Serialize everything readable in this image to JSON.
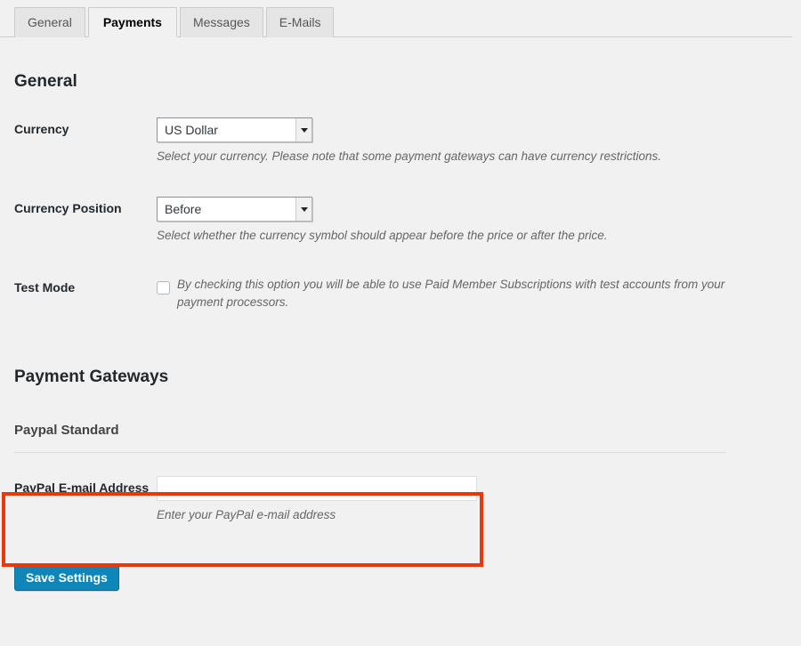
{
  "tabs": [
    {
      "label": "General",
      "active": false
    },
    {
      "label": "Payments",
      "active": true
    },
    {
      "label": "Messages",
      "active": false
    },
    {
      "label": "E-Mails",
      "active": false
    }
  ],
  "general": {
    "heading": "General",
    "currency": {
      "label": "Currency",
      "value": "US Dollar",
      "description": "Select your currency. Please note that some payment gateways can have currency restrictions."
    },
    "currency_position": {
      "label": "Currency Position",
      "value": "Before",
      "description": "Select whether the currency symbol should appear before the price or after the price."
    },
    "test_mode": {
      "label": "Test Mode",
      "checked": false,
      "description": "By checking this option you will be able to use Paid Member Subscriptions with test accounts from your payment processors."
    }
  },
  "payment_gateways": {
    "heading": "Payment Gateways",
    "paypal_standard": {
      "heading": "Paypal Standard",
      "email": {
        "label": "PayPal E-mail Address",
        "value": "",
        "placeholder": "",
        "description": "Enter your PayPal e-mail address"
      }
    }
  },
  "footer": {
    "save_label": "Save Settings"
  },
  "colors": {
    "highlight": "#e8380d",
    "button": "#0e87b8",
    "background": "#f1f1f1"
  }
}
